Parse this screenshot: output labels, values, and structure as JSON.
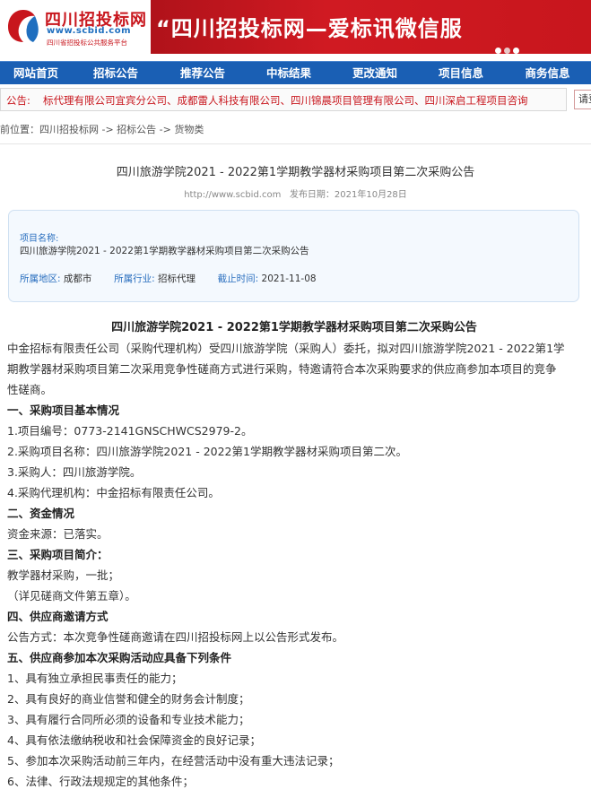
{
  "header": {
    "logo_title": "四川招投标网",
    "logo_url": "www.scbid.com",
    "logo_sub": "四川省招投标公共服务平台",
    "banner_text": "“四川招投标网—爱标讯微信服",
    "banner_dots": 3,
    "banner_active_dot": 2
  },
  "nav": {
    "items": [
      "网站首页",
      "招标公告",
      "推荐公告",
      "中标结果",
      "更改通知",
      "项目信息",
      "商务信息"
    ]
  },
  "notice": {
    "label": "公告:",
    "text": "标代理有限公司宜宾分公司、成都雷人科技有限公司、四川锦晨项目管理有限公司、四川深启工程项目咨询",
    "button": "请登录"
  },
  "breadcrumb": "前位置：四川招投标网 -> 招标公告 -> 货物类",
  "article": {
    "title": "四川旅游学院2021 - 2022第1学期教学器材采购项目第二次采购公告",
    "url": "http://www.scbid.com",
    "date_label": "发布日期：",
    "date": "2021年10月28日"
  },
  "info": {
    "name_label": "项目名称:",
    "name": "四川旅游学院2021 - 2022第1学期教学器材采购项目第二次采购公告",
    "region_label": "所属地区:",
    "region": "成都市",
    "industry_label": "所属行业:",
    "industry": "招标代理",
    "deadline_label": "截止时间:",
    "deadline": "2021-11-08"
  },
  "content": {
    "title": "四川旅游学院2021 - 2022第1学期教学器材采购项目第二次采购公告",
    "lines": [
      {
        "t": "中金招标有限责任公司（采购代理机构）受四川旅游学院（采购人）委托，拟对四川旅游学院2021 - 2022第1学",
        "h": false
      },
      {
        "t": "期教学器材采购项目第二次采用竞争性磋商方式进行采购，特邀请符合本次采购要求的供应商参加本项目的竞争",
        "h": false
      },
      {
        "t": "性磋商。",
        "h": false
      },
      {
        "t": "一、采购项目基本情况",
        "h": true
      },
      {
        "t": "1.项目编号：0773-2141GNSCHWCS2979-2。",
        "h": false
      },
      {
        "t": "2.采购项目名称：四川旅游学院2021 - 2022第1学期教学器材采购项目第二次。",
        "h": false
      },
      {
        "t": "3.采购人：四川旅游学院。",
        "h": false
      },
      {
        "t": "4.采购代理机构：中金招标有限责任公司。",
        "h": false
      },
      {
        "t": "二、资金情况",
        "h": true
      },
      {
        "t": "资金来源：已落实。",
        "h": false
      },
      {
        "t": "三、采购项目简介：",
        "h": true
      },
      {
        "t": "教学器材采购，一批；",
        "h": false
      },
      {
        "t": "（详见磋商文件第五章）。",
        "h": false
      },
      {
        "t": "四、供应商邀请方式",
        "h": true
      },
      {
        "t": "公告方式：本次竞争性磋商邀请在四川招投标网上以公告形式发布。",
        "h": false
      },
      {
        "t": "五、供应商参加本次采购活动应具备下列条件",
        "h": true
      },
      {
        "t": "1、具有独立承担民事责任的能力；",
        "h": false
      },
      {
        "t": "2、具有良好的商业信誉和健全的财务会计制度；",
        "h": false
      },
      {
        "t": "3、具有履行合同所必须的设备和专业技术能力；",
        "h": false
      },
      {
        "t": "4、具有依法缴纳税收和社会保障资金的良好记录；",
        "h": false
      },
      {
        "t": "5、参加本次采购活动前三年内，在经营活动中没有重大违法记录；",
        "h": false
      },
      {
        "t": "6、法律、行政法规规定的其他条件；",
        "h": false
      }
    ]
  },
  "colors": {
    "brand_red": "#c8161d",
    "nav_blue": "#1a5fb4",
    "label_blue": "#2a6fbf"
  }
}
